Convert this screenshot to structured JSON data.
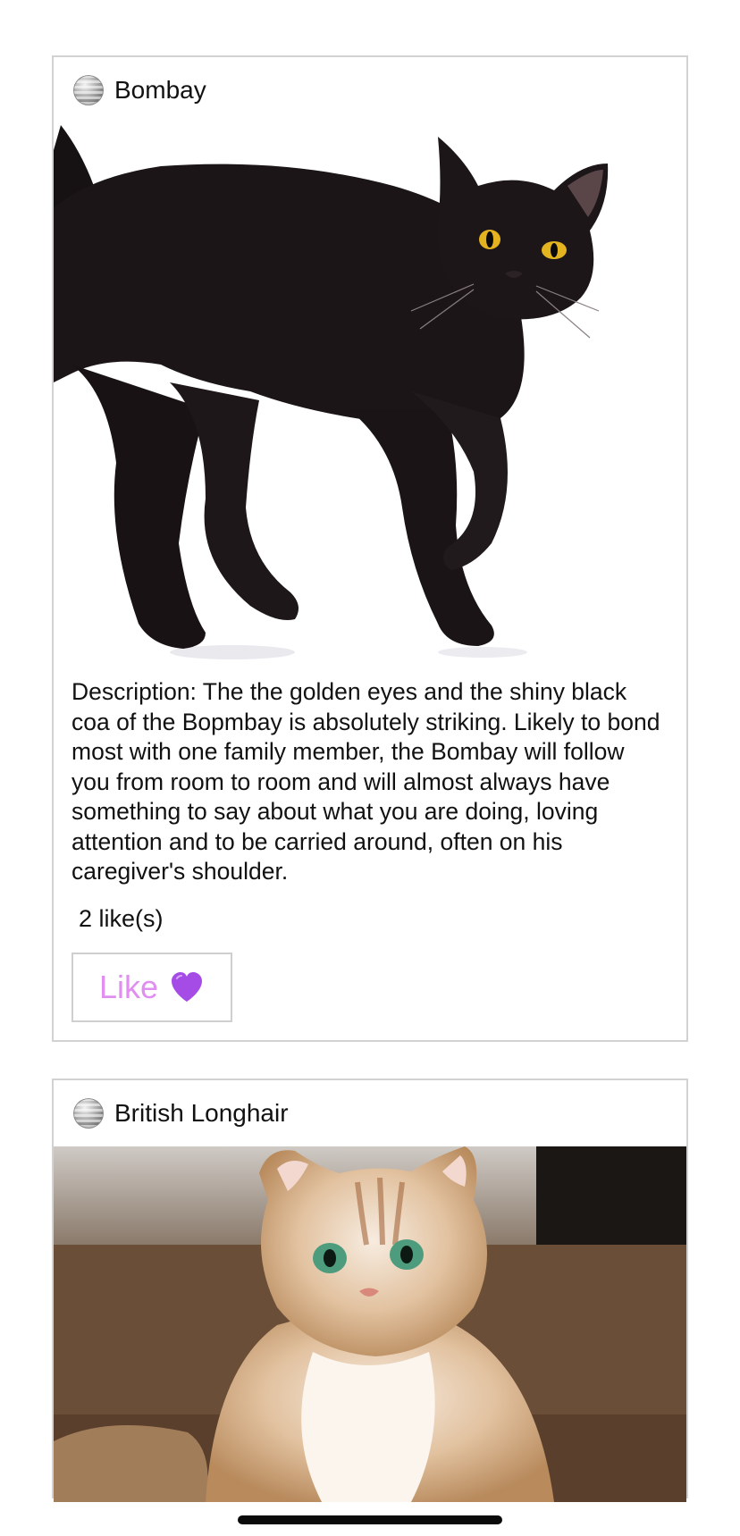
{
  "cards": [
    {
      "breed": "Bombay",
      "avatar_icon": "disco-ball-icon",
      "image_subject": "black cat photo",
      "description": "Description: The the golden eyes and the shiny black coa of the Bopmbay is absolutely striking. Likely to bond most with one family member, the Bombay will follow you from room to room and will almost always have something to say about what you are doing, loving attention and to be carried around, often on his caregiver's shoulder.",
      "likes": "2 like(s)",
      "like_label": "Like",
      "like_icon": "purple-heart-icon"
    },
    {
      "breed": "British Longhair",
      "avatar_icon": "disco-ball-icon",
      "image_subject": "cream longhair cat photo"
    }
  ],
  "colors": {
    "like_text": "#e08ff0",
    "heart": "#a54be6",
    "card_border": "#d2d2d2"
  }
}
